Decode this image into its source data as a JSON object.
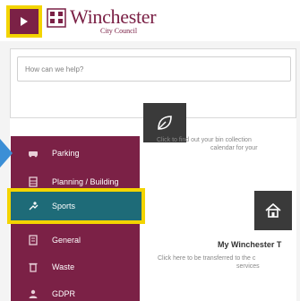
{
  "header": {
    "logo_name": "Winchester",
    "logo_sub": "City Council",
    "menu_icon": "play-icon"
  },
  "search": {
    "placeholder": "How can we help?"
  },
  "cards": {
    "bin_text_1": "Click to find out your bin collection",
    "bin_text_2": "calendar for your",
    "home_title": "My Winchester T",
    "home_desc_1": "Click here to be transferred to the c",
    "home_desc_2": "services"
  },
  "sidebar": {
    "items": [
      {
        "label": "Parking",
        "icon": "car-icon"
      },
      {
        "label": "Planning / Building",
        "icon": "building-icon"
      },
      {
        "label": "Sports",
        "icon": "sports-icon",
        "active": true
      },
      {
        "label": "General",
        "icon": "document-icon"
      },
      {
        "label": "Waste",
        "icon": "bin-icon"
      },
      {
        "label": "GDPR",
        "icon": "user-icon"
      }
    ]
  },
  "colors": {
    "brand": "#7b2146",
    "active": "#1e6b78",
    "highlight": "#f3d400",
    "arrow": "#3b8fd6"
  }
}
